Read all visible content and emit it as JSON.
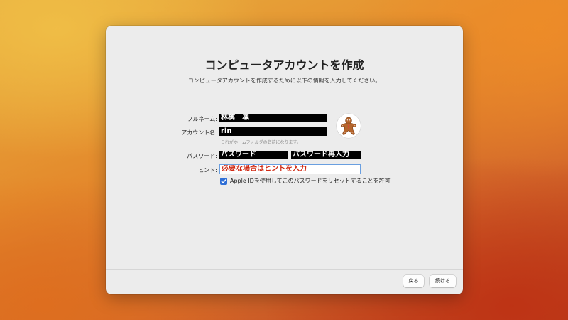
{
  "dialog": {
    "title": "コンピュータアカウントを作成",
    "subtitle": "コンピュータアカウントを作成するために以下の情報を入力してください。"
  },
  "form": {
    "fullname_label": "フルネーム:",
    "fullname_value": "林檎　凛",
    "account_label": "アカウント名:",
    "account_value": "rin",
    "account_help": "これがホームフォルダの名前になります。",
    "password_label": "パスワード:",
    "password_value": "パスワード",
    "password_confirm_value": "パスワード再入力",
    "hint_label": "ヒント:",
    "hint_value": "必要な場合はヒントを入力",
    "apple_id_checkbox_label": "Apple IDを使用してこのパスワードをリセットすることを許可",
    "apple_id_checkbox_checked": true
  },
  "avatar": {
    "icon": "gingerbread-man-icon"
  },
  "footer": {
    "back_label": "戻る",
    "continue_label": "続ける"
  }
}
